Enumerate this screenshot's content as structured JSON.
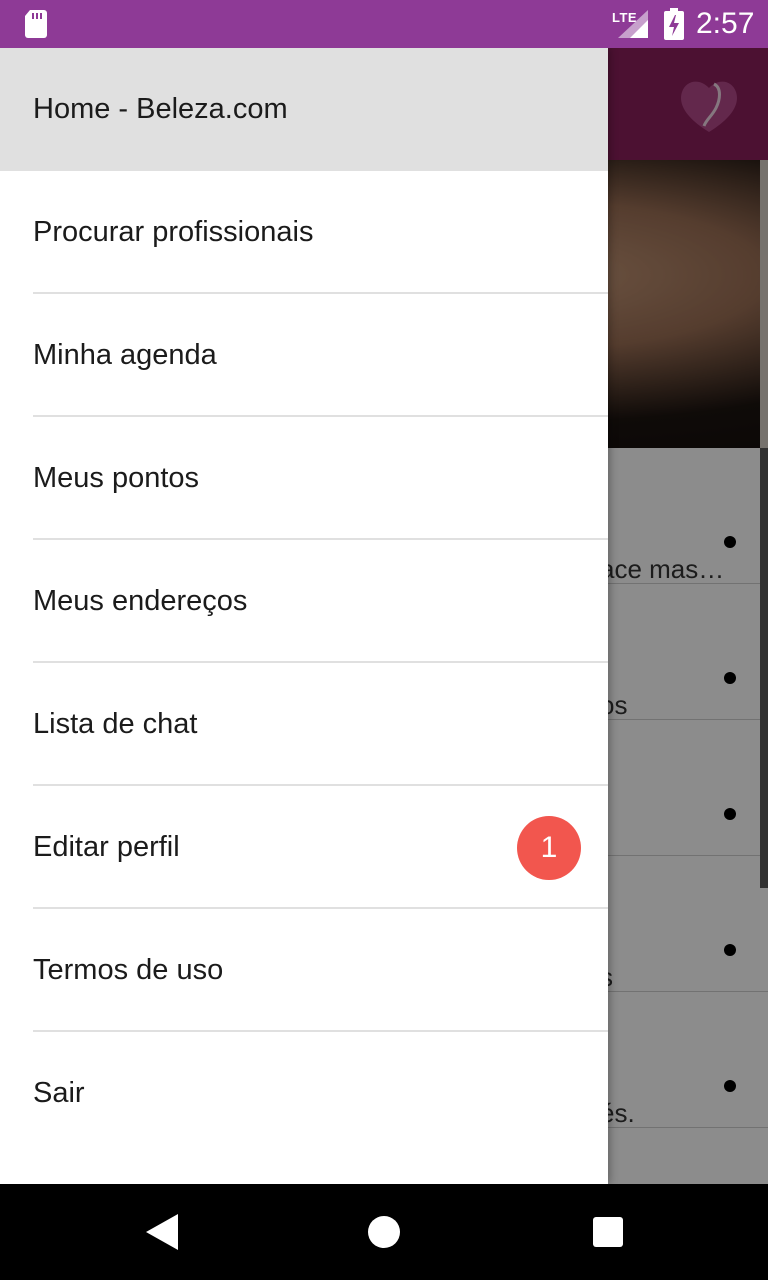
{
  "status_bar": {
    "network": "LTE",
    "time": "2:57",
    "icons": [
      "sd-card-icon",
      "signal-icon",
      "battery-charging-icon"
    ]
  },
  "background_list": {
    "rows": [
      {
        "text": "ace mas…"
      },
      {
        "text": "os"
      },
      {
        "text": ""
      },
      {
        "text": "s"
      },
      {
        "text": "és."
      }
    ]
  },
  "drawer": {
    "items": [
      {
        "label": "Home - Beleza.com",
        "active": true
      },
      {
        "label": "Procurar profissionais"
      },
      {
        "label": "Minha agenda"
      },
      {
        "label": "Meus pontos"
      },
      {
        "label": "Meus endereços"
      },
      {
        "label": "Lista de chat"
      },
      {
        "label": "Editar perfil",
        "badge": "1"
      },
      {
        "label": "Termos de uso"
      },
      {
        "label": "Sair"
      }
    ]
  },
  "colors": {
    "status_bar": "#8e3a96",
    "app_header": "#8b1f5c",
    "badge": "#f2564e",
    "active_item": "#e0e0e0"
  },
  "nav_bar": {
    "buttons": [
      "back-icon",
      "home-icon",
      "recents-icon"
    ]
  }
}
